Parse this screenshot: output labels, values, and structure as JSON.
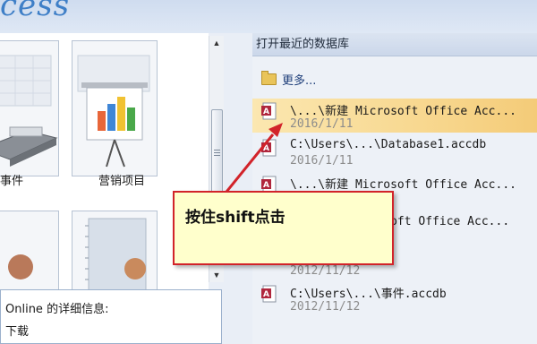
{
  "window": {
    "brand_text": "cess"
  },
  "templates": {
    "items": [
      {
        "label": "事件",
        "icon": "event-desk-icon"
      },
      {
        "label": "营销项目",
        "icon": "marketing-chart-icon"
      },
      {
        "label": "",
        "icon": "contacts-person-icon"
      },
      {
        "label": "",
        "icon": "notebook-person-icon"
      }
    ]
  },
  "info_panel": {
    "title": "Online 的详细信息:",
    "download": "下载"
  },
  "recent": {
    "header": "打开最近的数据库",
    "more": "更多...",
    "items": [
      {
        "path": "\\...\\新建 Microsoft Office Acc...",
        "date": "2016/1/11",
        "highlighted": true
      },
      {
        "path": "C:\\Users\\...\\Database1.accdb",
        "date": "2016/1/11",
        "highlighted": false
      },
      {
        "path": "\\...\\新建 Microsoft Office Acc...",
        "date": "",
        "highlighted": false
      },
      {
        "path": "...\\新建 Microsoft Office Acc...",
        "date": "",
        "highlighted": false
      },
      {
        "path": "",
        "date": "2012/11/12",
        "highlighted": false
      },
      {
        "path": "C:\\Users\\...\\事件.accdb",
        "date": "2012/11/12",
        "highlighted": false
      }
    ]
  },
  "annotation": {
    "text": "按住shift点击",
    "border_color": "#d2232a",
    "fill_color": "#ffffcc"
  }
}
